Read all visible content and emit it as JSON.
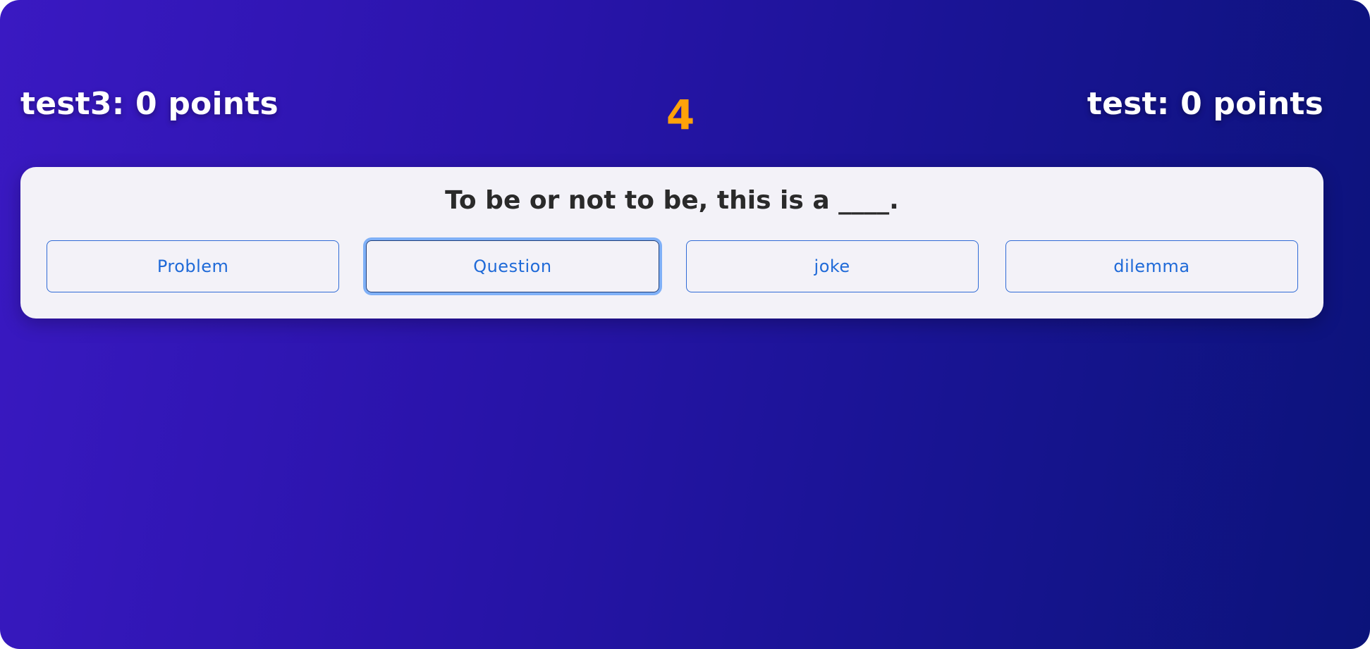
{
  "players": {
    "left": {
      "label": "test3: 0 points"
    },
    "right": {
      "label": "test: 0 points"
    }
  },
  "timer": {
    "value": "4"
  },
  "question": {
    "text": "To be or not to be, this is a ____."
  },
  "answers": [
    {
      "label": "Problem",
      "focused": false
    },
    {
      "label": "Question",
      "focused": true
    },
    {
      "label": "joke",
      "focused": false
    },
    {
      "label": "dilemma",
      "focused": false
    }
  ],
  "colors": {
    "background_start": "#3a19c2",
    "background_end": "#0b137a",
    "timer": "#ffa20a",
    "answer_text": "#1f6ad8",
    "focus_ring": "#7fb0f7",
    "card": "#f3f2f8"
  }
}
